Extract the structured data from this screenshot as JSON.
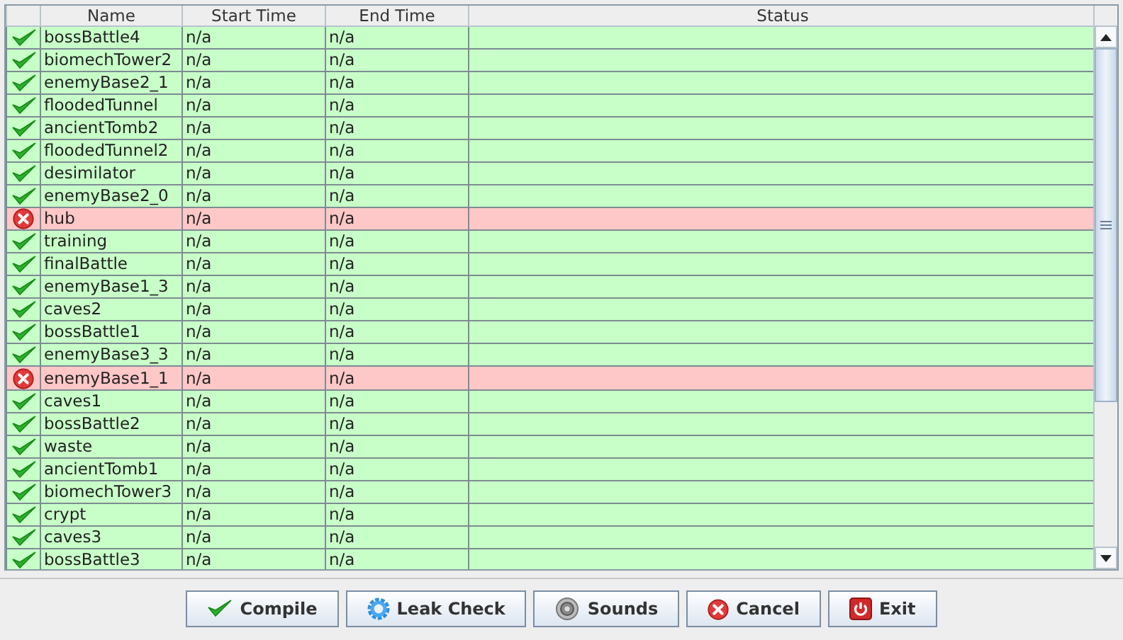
{
  "table": {
    "columns": [
      {
        "label": "Name"
      },
      {
        "label": "Start Time"
      },
      {
        "label": "End Time"
      },
      {
        "label": "Status"
      }
    ],
    "rows": [
      {
        "kind": "ok",
        "name": "bossBattle4",
        "start": "n/a",
        "end": "n/a"
      },
      {
        "kind": "ok",
        "name": "biomechTower2",
        "start": "n/a",
        "end": "n/a"
      },
      {
        "kind": "ok",
        "name": "enemyBase2_1",
        "start": "n/a",
        "end": "n/a"
      },
      {
        "kind": "ok",
        "name": "floodedTunnel",
        "start": "n/a",
        "end": "n/a"
      },
      {
        "kind": "ok",
        "name": "ancientTomb2",
        "start": "n/a",
        "end": "n/a"
      },
      {
        "kind": "ok",
        "name": "floodedTunnel2",
        "start": "n/a",
        "end": "n/a"
      },
      {
        "kind": "ok",
        "name": "desimilator",
        "start": "n/a",
        "end": "n/a"
      },
      {
        "kind": "ok",
        "name": "enemyBase2_0",
        "start": "n/a",
        "end": "n/a"
      },
      {
        "kind": "error",
        "name": "hub",
        "start": "n/a",
        "end": "n/a"
      },
      {
        "kind": "ok",
        "name": "training",
        "start": "n/a",
        "end": "n/a"
      },
      {
        "kind": "ok",
        "name": "finalBattle",
        "start": "n/a",
        "end": "n/a"
      },
      {
        "kind": "ok",
        "name": "enemyBase1_3",
        "start": "n/a",
        "end": "n/a"
      },
      {
        "kind": "ok",
        "name": "caves2",
        "start": "n/a",
        "end": "n/a"
      },
      {
        "kind": "ok",
        "name": "bossBattle1",
        "start": "n/a",
        "end": "n/a"
      },
      {
        "kind": "ok",
        "name": "enemyBase3_3",
        "start": "n/a",
        "end": "n/a"
      },
      {
        "kind": "error",
        "name": "enemyBase1_1",
        "start": "n/a",
        "end": "n/a"
      },
      {
        "kind": "ok",
        "name": "caves1",
        "start": "n/a",
        "end": "n/a"
      },
      {
        "kind": "ok",
        "name": "bossBattle2",
        "start": "n/a",
        "end": "n/a"
      },
      {
        "kind": "ok",
        "name": "waste",
        "start": "n/a",
        "end": "n/a"
      },
      {
        "kind": "ok",
        "name": "ancientTomb1",
        "start": "n/a",
        "end": "n/a"
      },
      {
        "kind": "ok",
        "name": "biomechTower3",
        "start": "n/a",
        "end": "n/a"
      },
      {
        "kind": "ok",
        "name": "crypt",
        "start": "n/a",
        "end": "n/a"
      },
      {
        "kind": "ok",
        "name": "caves3",
        "start": "n/a",
        "end": "n/a"
      },
      {
        "kind": "ok",
        "name": "bossBattle3",
        "start": "n/a",
        "end": "n/a"
      }
    ]
  },
  "buttons": [
    {
      "kind": "compile",
      "label": "Compile"
    },
    {
      "kind": "leak",
      "label": "Leak Check"
    },
    {
      "kind": "sounds",
      "label": "Sounds"
    },
    {
      "kind": "cancel",
      "label": "Cancel"
    },
    {
      "kind": "exit",
      "label": "Exit"
    }
  ]
}
